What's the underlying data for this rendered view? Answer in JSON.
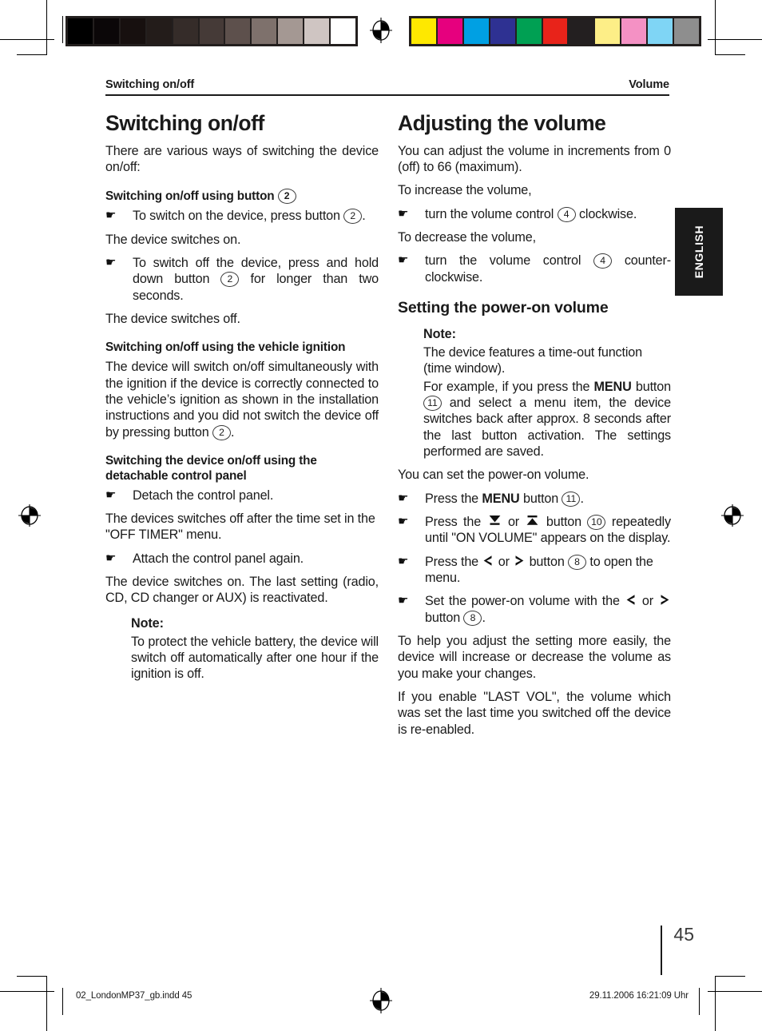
{
  "document": {
    "header": {
      "left": "Switching on/off",
      "right": "Volume"
    },
    "language_tab": "ENGLISH",
    "page_number": "45",
    "footer": {
      "file": "02_LondonMP37_gb.indd   45",
      "timestamp": "29.11.2006   16:21:09 Uhr"
    }
  },
  "calibration": {
    "grayscale": [
      "#000000",
      "#0b0708",
      "#17100f",
      "#231c1a",
      "#352c29",
      "#453a37",
      "#5d504c",
      "#7e716c",
      "#a49893",
      "#cfc5c2",
      "#ffffff"
    ],
    "color": [
      "#fee800",
      "#e6007e",
      "#00a0e3",
      "#2e3192",
      "#00a053",
      "#e8231a",
      "#231f20",
      "#fdee87",
      "#f491c4",
      "#7fd5f5",
      "#8e8e8e"
    ]
  },
  "left_column": {
    "heading": "Switching on/off",
    "intro": "There are various ways of switching the device on/off:",
    "sub1": {
      "title_text": "Switching on/off using button",
      "title_button": "2",
      "step1_pre": "To switch on the device, press button",
      "step1_button": "2",
      "step1_post": ".",
      "result1": "The device switches on.",
      "step2_pre": "To switch off the device, press and hold down button",
      "step2_button": "2",
      "step2_post": "for longer than two seconds.",
      "result2": "The device switches off."
    },
    "sub2": {
      "title": "Switching on/off using the vehicle ignition",
      "body_pre": "The device will switch on/off simultaneously with the ignition if the device is correctly connected to the vehicle’s ignition as shown in the installation instructions and you did not switch the device off by pressing button",
      "body_button": "2",
      "body_post": "."
    },
    "sub3": {
      "title": "Switching the device on/off using the detachable control panel",
      "step1": "Detach the control panel.",
      "result1": "The devices switches off after the time set in the \"OFF TIMER\" menu.",
      "step2": "Attach the control panel again.",
      "result2": "The device switches on. The last setting (radio, CD, CD changer or AUX) is reactivated.",
      "note_title": "Note:",
      "note_body": "To protect the vehicle battery, the device will switch off automatically after one hour if the ignition is off."
    }
  },
  "right_column": {
    "heading": "Adjusting the volume",
    "intro": "You can adjust the volume in increments from 0 (off) to 66 (maximum).",
    "increase_lead": "To increase the volume,",
    "increase_step_pre": "turn the volume control",
    "increase_step_button": "4",
    "increase_step_post": "clockwise.",
    "decrease_lead": "To decrease the volume,",
    "decrease_step_pre": "turn the volume control",
    "decrease_step_button": "4",
    "decrease_step_post": "counter-clockwise.",
    "sub1": {
      "title": "Setting the power-on volume",
      "note_title": "Note:",
      "note_p1": "The device features a time-out function (time window).",
      "note_p2_pre": "For example, if you press the",
      "note_p2_kw": "MENU",
      "note_p2_mid": "button",
      "note_p2_button": "11",
      "note_p2_post": "and select a menu item, the device switches back after approx. 8 seconds after the last button activation. The settings performed are saved.",
      "lead": "You can set the power-on volume.",
      "step1_pre": "Press the",
      "step1_kw": "MENU",
      "step1_mid": "button",
      "step1_button": "11",
      "step1_post": ".",
      "step2_pre": "Press the",
      "step2_glyph_a": "down-arrow-bar",
      "step2_or": "or",
      "step2_glyph_b": "up-arrow-bar",
      "step2_mid": "button",
      "step2_button": "10",
      "step2_post": "repeatedly until \"ON VOLUME\" appears on the display.",
      "step3_pre": "Press the",
      "step3_glyph_a": "left-chevron",
      "step3_or": "or",
      "step3_glyph_b": "right-chevron",
      "step3_mid": "button",
      "step3_button": "8",
      "step3_post": "to open the menu.",
      "step4_pre": "Set the power-on volume with the",
      "step4_glyph_a": "left-chevron",
      "step4_or": "or",
      "step4_glyph_b": "right-chevron",
      "step4_mid": "button",
      "step4_button": "8",
      "step4_post": ".",
      "outro1": "To help you adjust the setting more easily, the device will increase or decrease the volume as you make your changes.",
      "outro2": "If you enable \"LAST VOL\", the volume which was set the last time you switched off the device is re-enabled."
    }
  },
  "icons": {
    "hand": "☛",
    "down_arrow_bar": "↓",
    "up_arrow_bar": "↑",
    "left_chevron": "❮",
    "right_chevron": "❯"
  }
}
